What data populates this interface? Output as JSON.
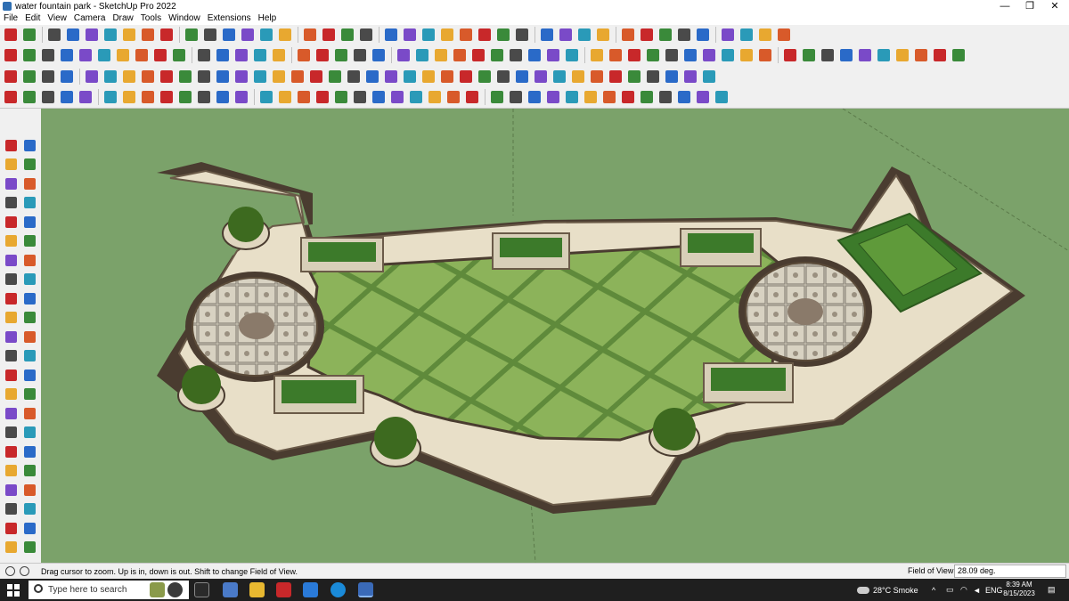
{
  "window": {
    "title": "water fountain park - SketchUp Pro 2022",
    "minimize_glyph": "—",
    "maximize_glyph": "❐",
    "close_glyph": "✕"
  },
  "menu": [
    "File",
    "Edit",
    "View",
    "Camera",
    "Draw",
    "Tools",
    "Window",
    "Extensions",
    "Help"
  ],
  "status": {
    "message": "Drag cursor to zoom.  Up is in, down is out. Shift to change Field of View.",
    "vcb_label": "Field of View",
    "vcb_value": "28.09 deg."
  },
  "taskbar": {
    "search_placeholder": "Type here to search",
    "weather": "28°C  Smoke",
    "language": "ENG",
    "time": "8:39 AM",
    "date": "8/15/2023"
  },
  "colors": {
    "grass": "#7ba26a",
    "pavement": "#e8dfc8",
    "border_dark": "#4a3c30",
    "planter_green": "#3c7a2a"
  }
}
